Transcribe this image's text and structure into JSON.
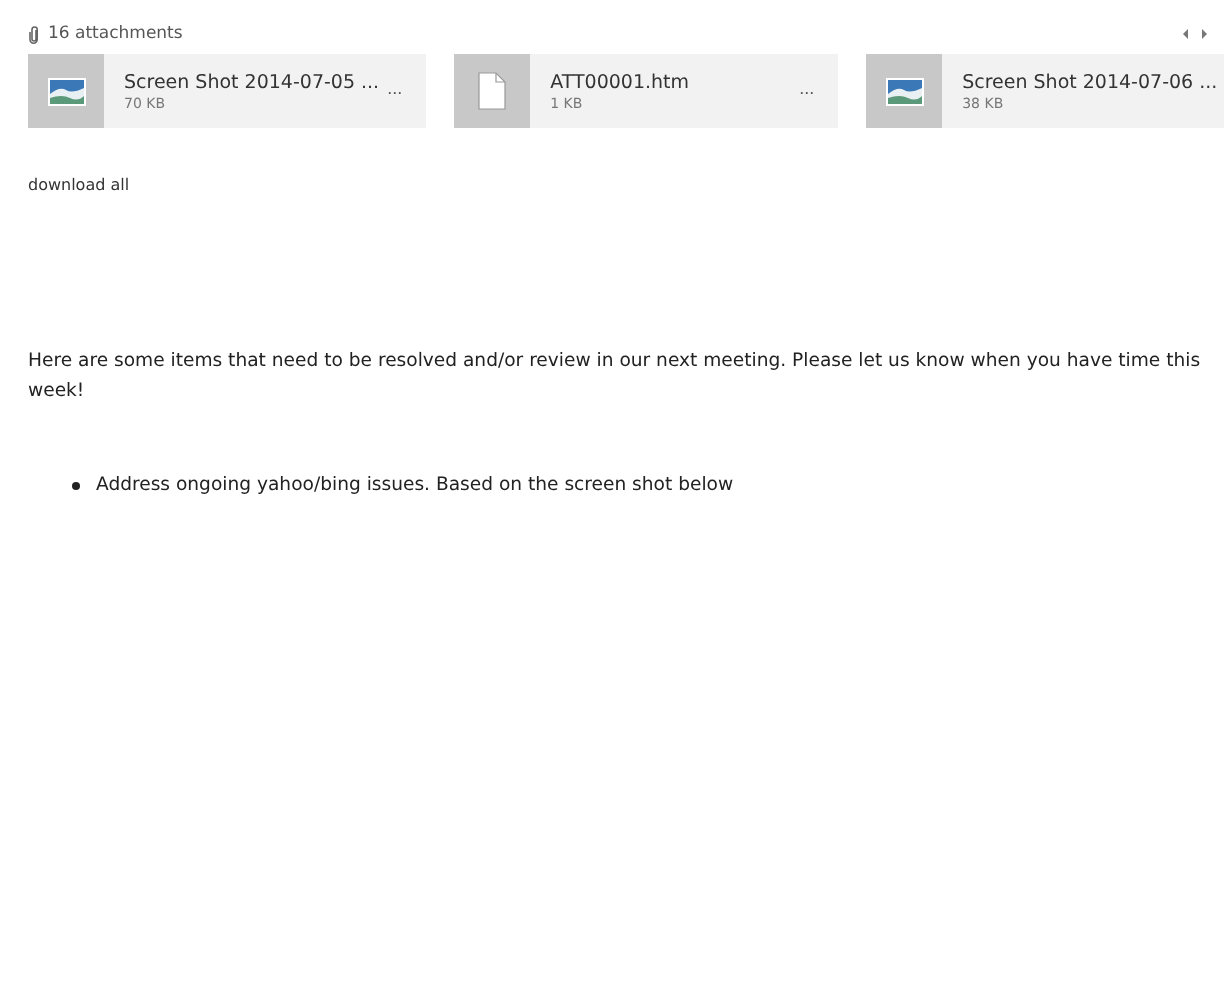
{
  "attachments": {
    "count_label": "16 attachments",
    "items": [
      {
        "kind": "image",
        "name": "Screen Shot 2014-07-05 ...",
        "size": "70 KB",
        "menu": "..."
      },
      {
        "kind": "file",
        "name": "ATT00001.htm",
        "size": "1 KB",
        "menu": "..."
      },
      {
        "kind": "image",
        "name": "Screen Shot 2014-07-06 ...",
        "size": "38 KB"
      }
    ],
    "download_all": "download all"
  },
  "body": {
    "paragraph": "Here are some items that need to be resolved and/or review in our next meeting. Please let us know when you have time this week!",
    "bullets": [
      "Address ongoing yahoo/bing issues. Based on the screen shot below"
    ]
  }
}
